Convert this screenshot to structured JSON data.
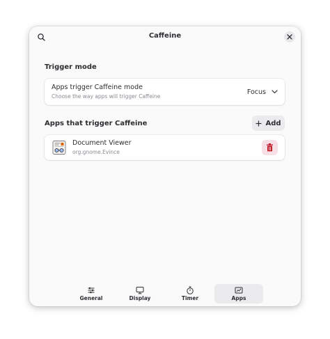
{
  "header": {
    "title": "Caffeine",
    "search_icon": "search-icon",
    "close_icon": "close-icon"
  },
  "trigger_mode": {
    "section_title": "Trigger mode",
    "row_title": "Apps trigger Caffeine mode",
    "row_subtitle": "Choose the way apps will trigger Caffeine",
    "selected_value": "Focus"
  },
  "apps_section": {
    "section_title": "Apps that trigger Caffeine",
    "add_label": "Add",
    "apps": [
      {
        "name": "Document Viewer",
        "id": "org.gnome.Evince",
        "icon": "document-viewer-icon"
      }
    ]
  },
  "tabs": [
    {
      "label": "General",
      "icon": "sliders-icon",
      "active": false
    },
    {
      "label": "Display",
      "icon": "monitor-icon",
      "active": false
    },
    {
      "label": "Timer",
      "icon": "stopwatch-icon",
      "active": false
    },
    {
      "label": "Apps",
      "icon": "apps-icon",
      "active": true
    }
  ],
  "colors": {
    "window_bg": "#fafafb",
    "delete_bg": "#f7e0e5",
    "delete_fg": "#c01c28",
    "text": "#2e2e33"
  }
}
